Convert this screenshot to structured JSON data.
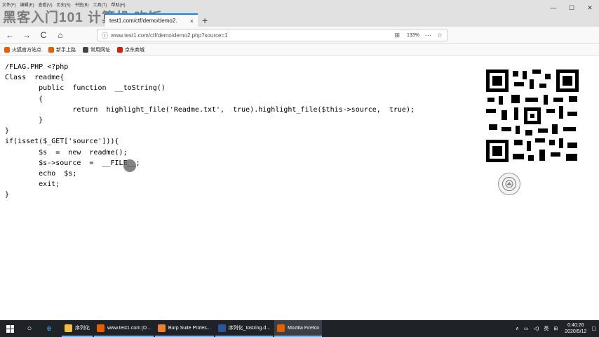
{
  "menubar": [
    "文件(F)",
    "编辑(E)",
    "查看(V)",
    "历史(S)",
    "书签(B)",
    "工具(T)",
    "帮助(H)"
  ],
  "overlay_watermark": "黑客入门101 计算机 吃饭",
  "tab": {
    "title": "test1.com/ctf/demo/demo2.",
    "close": "×",
    "new": "+"
  },
  "window_controls": {
    "minimize": "—",
    "maximize": "☐",
    "close": "✕"
  },
  "nav": {
    "back": "←",
    "forward": "→",
    "reload": "C",
    "home": "⌂"
  },
  "url": {
    "text": "www.test1.com/ctf/demo/demo2.php?source=1",
    "zoom": "133%",
    "icon": "info-icon"
  },
  "bookmarks": [
    {
      "label": "火狐官方站点",
      "color": "#e66000"
    },
    {
      "label": "新手上路",
      "color": "#e66000"
    },
    {
      "label": "常用网址",
      "color": "#444444"
    },
    {
      "label": "京东商城",
      "color": "#d81e06"
    }
  ],
  "code_lines": [
    "/FLAG.PHP <?php",
    "Class  readme{",
    "        public  function  __toString()",
    "        {",
    "                return  highlight_file('Readme.txt',  true).highlight_file($this->source,  true);",
    "        }",
    "}",
    "if(isset($_GET['source'])){",
    "        $s  =  new  readme();",
    "        $s->source  =  __FILE__;",
    "        echo  $s;",
    "        exit;",
    "}"
  ],
  "taskbar": {
    "apps": [
      {
        "label": "序列化",
        "color": "#f0c040",
        "active": false
      },
      {
        "label": "www.test1.com [D...",
        "color": "#e66000",
        "active": false
      },
      {
        "label": "Burp Suite Profes...",
        "color": "#f08030",
        "active": false
      },
      {
        "label": "序列化_tostring.d...",
        "color": "#2b579a",
        "active": false
      },
      {
        "label": "Mozilla Firefox",
        "color": "#e66000",
        "active": true
      }
    ],
    "tray_lang": "英",
    "clock_time": "0:40:26",
    "clock_date": "2020/5/12"
  }
}
